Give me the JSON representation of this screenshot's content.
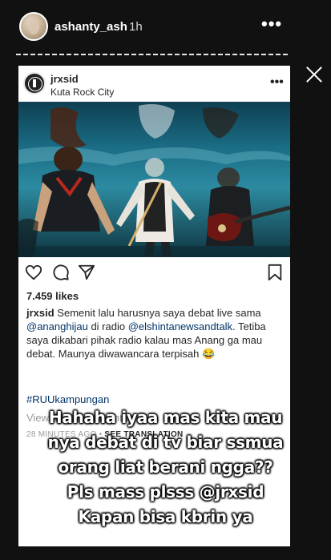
{
  "story": {
    "username": "ashanty_ash",
    "time": "1h",
    "more_label": "•••"
  },
  "post": {
    "username": "jrxsid",
    "location": "Kuta Rock City",
    "more_label": "•••",
    "likes": "7.459 likes",
    "caption_user": "jrxsid",
    "caption_parts": [
      " Semenit lalu harusnya saya debat live sama ",
      "@ananghijau",
      " di radio ",
      "@elshintanewsandtalk",
      ". Tetiba saya dikabari pihak radio kalau mas Anang ga mau debat. Maunya diwawancara terpisah 😂"
    ],
    "hashtag": "#RUUkampungan",
    "view_comments": "View all 21 comments",
    "timestamp": "28 MINUTES AGO",
    "separator": "•",
    "see_translation": "SEE TRANSLATION"
  },
  "overlay": {
    "lines": [
      "Hahaha iyaa mas kita mau",
      "nya debat di tv biar ssmua",
      "orang liat berani ngga??",
      "Pls mass plsss @jrxsid",
      "Kapan bisa kbrin ya"
    ]
  },
  "icons": {
    "close": "close-icon",
    "like": "heart-icon",
    "comment": "comment-icon",
    "share": "paper-plane-icon",
    "save": "bookmark-icon"
  }
}
